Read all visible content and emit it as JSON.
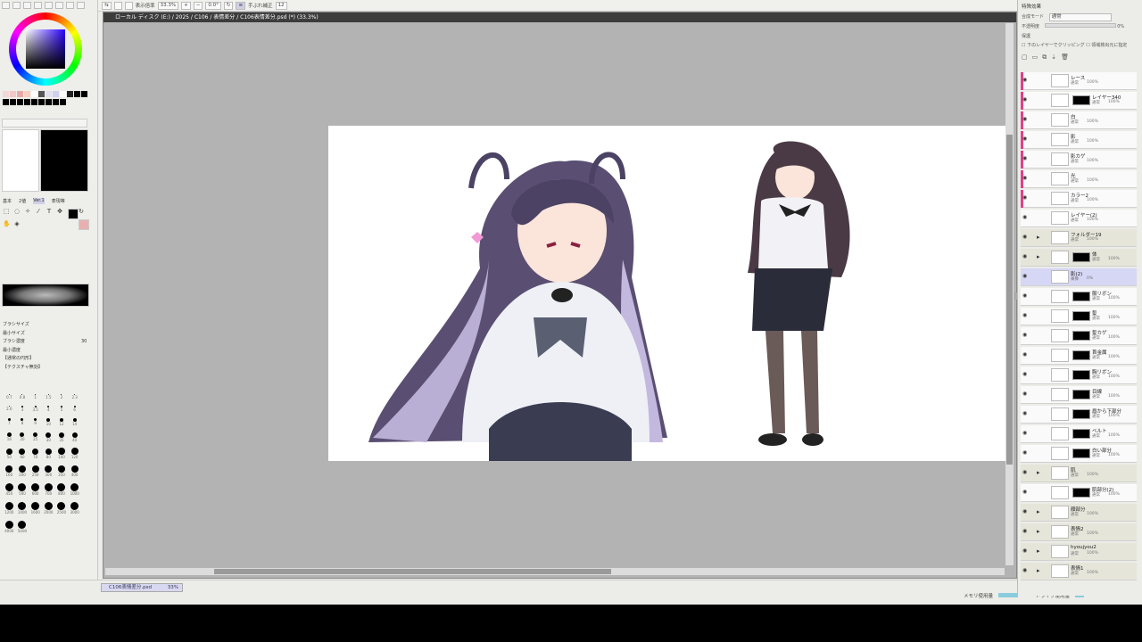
{
  "toolbar": {
    "zoom_label": "表示倍率",
    "zoom": "33.3%",
    "angle": "0.0°",
    "stabilizer_label": "手ぶれ補正",
    "stabilizer": "12"
  },
  "canvas": {
    "title": "ローカル ディスク (E:) / 2025 / C106 / 表情差分 / C106表情差分.psd (*) (33.3%)"
  },
  "status": {
    "file_tab": "C106表情差分.psd",
    "file_zoom": "33%",
    "memory": "メモリ使用量",
    "drive": "ドライブ使用量"
  },
  "left_panel": {
    "brush_size_label": "ブラシサイズ",
    "min_size_label": "最小サイズ",
    "density_label": "ブラシ濃度",
    "min_density_label": "最小濃度",
    "density_value": "30",
    "normal_circle": "【通常の円形】",
    "texture_label": "【テクスチャ無効】",
    "tool_tabs": [
      "基本",
      "2値",
      "Ver.1",
      "表現等"
    ],
    "brush_rows": [
      [
        "0.7",
        "0.8",
        "1",
        "1.5",
        "2"
      ],
      [
        "2.3",
        "2.6",
        "3",
        "3.5",
        "4"
      ],
      [
        "5",
        "6",
        "7",
        "8",
        "9"
      ],
      [
        "10",
        "12",
        "14",
        "16",
        "20"
      ],
      [
        "25",
        "30",
        "35",
        "40",
        "50"
      ],
      [
        "60",
        "70",
        "80",
        "100",
        "120"
      ],
      [
        "160",
        "200",
        "250",
        "300",
        "350"
      ],
      [
        "400",
        "450",
        "500",
        "600",
        "700"
      ],
      [
        "800",
        "1000",
        "1200",
        "1400",
        "1600"
      ],
      [
        "2000",
        "2500",
        "3000",
        "4000",
        "5000"
      ]
    ]
  },
  "right_panel": {
    "header": "特殊効果",
    "blend_label": "合成モード",
    "blend_value": "通常",
    "opacity_label": "不透明度",
    "opacity_value": "0%",
    "protect_label": "保護",
    "clip_label": "下のレイヤーでクリッピング",
    "sel_label": "領域検出元に指定",
    "layers": [
      {
        "name": "レース",
        "mode": "通常",
        "opacity": "100%",
        "type": "layer",
        "clip": true,
        "mask": false
      },
      {
        "name": "レイヤー340",
        "mode": "通常",
        "opacity": "100%",
        "type": "layer",
        "clip": true,
        "mask": true
      },
      {
        "name": "白",
        "mode": "通常",
        "opacity": "100%",
        "type": "layer",
        "clip": true,
        "mask": false
      },
      {
        "name": "影",
        "mode": "通常",
        "opacity": "100%",
        "type": "layer",
        "clip": true,
        "mask": false
      },
      {
        "name": "影カゲ",
        "mode": "通常",
        "opacity": "100%",
        "type": "layer",
        "clip": true,
        "mask": false
      },
      {
        "name": "光",
        "mode": "通常",
        "opacity": "100%",
        "type": "layer",
        "clip": true,
        "mask": false
      },
      {
        "name": "カラー2",
        "mode": "通常",
        "opacity": "100%",
        "type": "layer",
        "clip": true,
        "mask": false
      },
      {
        "name": "レイヤー(2)",
        "mode": "通常",
        "opacity": "100%",
        "type": "layer",
        "clip": false,
        "mask": false
      },
      {
        "name": "フォルダー19",
        "mode": "通常",
        "opacity": "100%",
        "type": "folder",
        "clip": false,
        "mask": false
      },
      {
        "name": "体",
        "mode": "通常",
        "opacity": "100%",
        "type": "folder",
        "clip": false,
        "mask": true
      },
      {
        "name": "影(2)",
        "mode": "乗算",
        "opacity": "0%",
        "type": "selected",
        "clip": false,
        "mask": false
      },
      {
        "name": "服リボン",
        "mode": "通常",
        "opacity": "100%",
        "type": "layer",
        "clip": false,
        "mask": true
      },
      {
        "name": "髪",
        "mode": "通常",
        "opacity": "100%",
        "type": "layer",
        "clip": false,
        "mask": true
      },
      {
        "name": "髪カゲ",
        "mode": "通常",
        "opacity": "100%",
        "type": "layer",
        "clip": false,
        "mask": true
      },
      {
        "name": "首金属",
        "mode": "通常",
        "opacity": "100%",
        "type": "layer",
        "clip": false,
        "mask": true
      },
      {
        "name": "胸リボン",
        "mode": "通常",
        "opacity": "100%",
        "type": "layer",
        "clip": false,
        "mask": true
      },
      {
        "name": "目線",
        "mode": "通常",
        "opacity": "100%",
        "type": "layer",
        "clip": false,
        "mask": true
      },
      {
        "name": "眉から下部分",
        "mode": "通常",
        "opacity": "100%",
        "type": "layer",
        "clip": false,
        "mask": true
      },
      {
        "name": "ベルト",
        "mode": "通常",
        "opacity": "100%",
        "type": "layer",
        "clip": false,
        "mask": true
      },
      {
        "name": "白い部分",
        "mode": "通常",
        "opacity": "100%",
        "type": "layer",
        "clip": false,
        "mask": true
      },
      {
        "name": "肌",
        "mode": "通常",
        "opacity": "100%",
        "type": "folder",
        "clip": false,
        "mask": false
      },
      {
        "name": "肌部分(2)",
        "mode": "通常",
        "opacity": "100%",
        "type": "layer",
        "clip": false,
        "mask": true
      },
      {
        "name": "顔部分",
        "mode": "通常",
        "opacity": "100%",
        "type": "folder",
        "clip": false,
        "mask": false
      },
      {
        "name": "表情2",
        "mode": "通常",
        "opacity": "100%",
        "type": "folder",
        "clip": false,
        "mask": false
      },
      {
        "name": "hyoujyou2",
        "mode": "通常",
        "opacity": "100%",
        "type": "folder",
        "clip": false,
        "mask": false
      },
      {
        "name": "表情1",
        "mode": "通常",
        "opacity": "100%",
        "type": "folder",
        "clip": false,
        "mask": false
      }
    ]
  }
}
